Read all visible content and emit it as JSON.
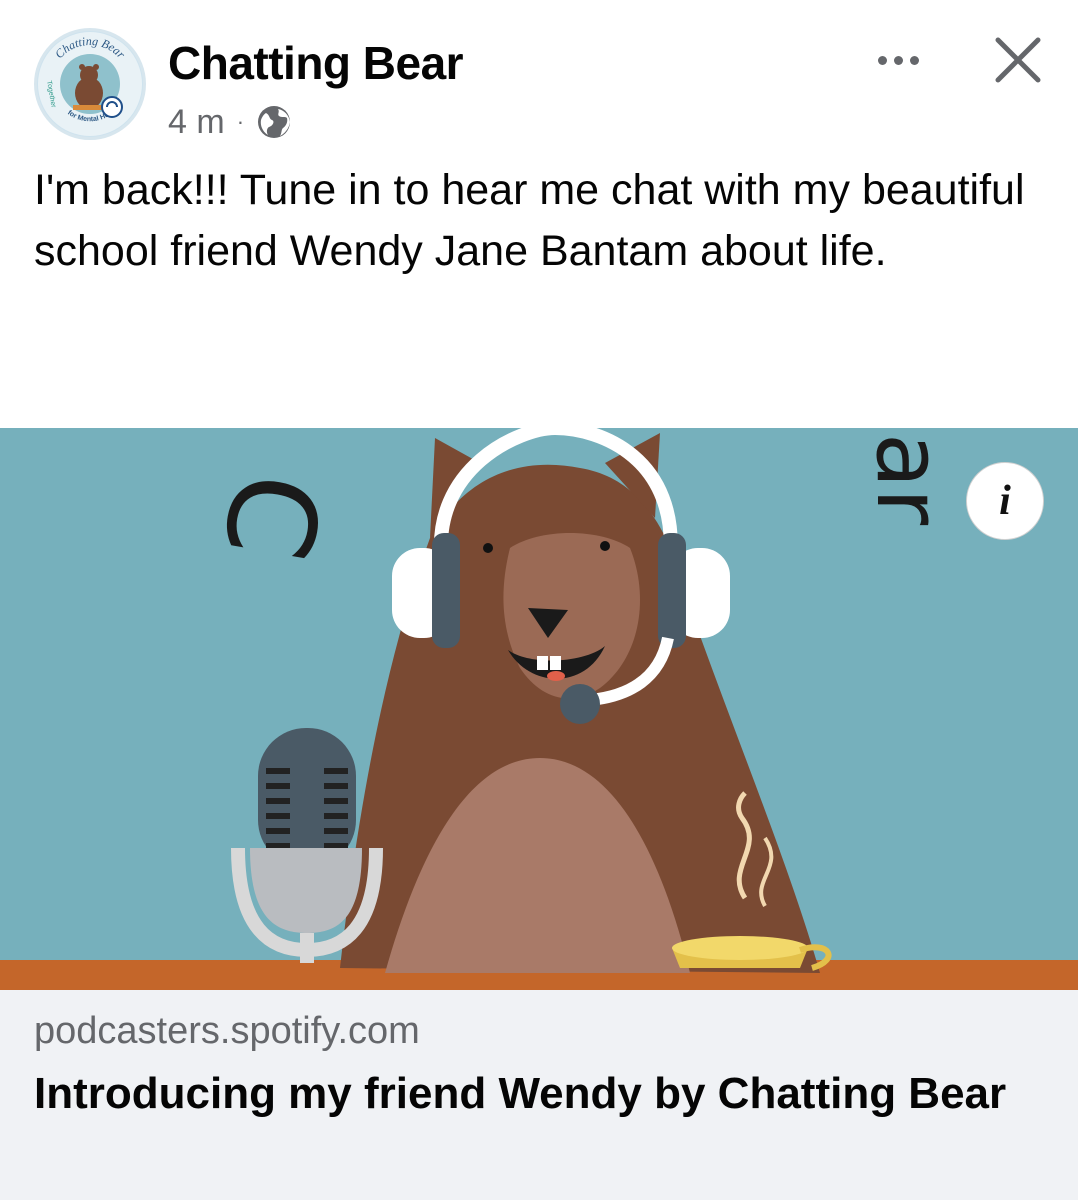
{
  "post": {
    "author": "Chatting Bear",
    "time": "4 m",
    "separator": "·",
    "audience_icon": "globe-icon",
    "text": "I'm back!!!  Tune in to hear me chat with my beautiful school friend Wendy Jane Bantam about life."
  },
  "avatar": {
    "top_text": "Chatting Bear",
    "side_text": "Together",
    "bottom_text": "for Mental Health"
  },
  "header_actions": {
    "more_icon": "more-options-icon",
    "close_icon": "close-icon"
  },
  "link_preview": {
    "image_text_left": "C",
    "image_text_right": "ar",
    "info_label": "i",
    "domain": "podcasters.spotify.com",
    "title": "Introducing my friend Wendy by Chatting Bear"
  },
  "colors": {
    "image_background": "#76b0bc",
    "bear_brown": "#7a4a33",
    "link_bar_background": "#f0f2f5",
    "secondary_text": "#65676b"
  }
}
